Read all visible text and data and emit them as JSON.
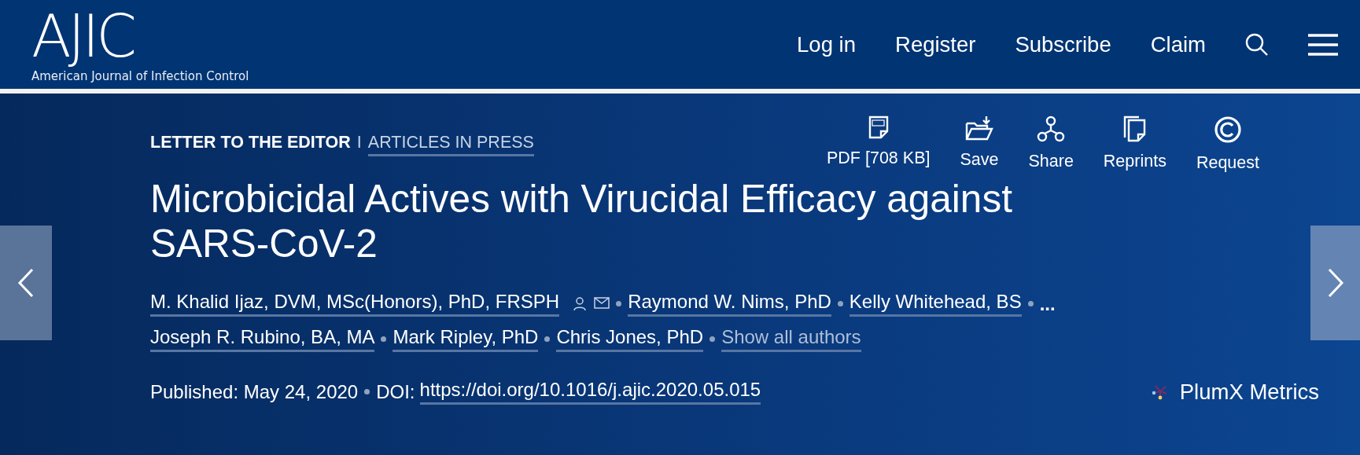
{
  "header": {
    "logo": {
      "mark": "AJIC",
      "subtitle": "American Journal of Infection Control"
    },
    "nav": [
      "Log in",
      "Register",
      "Subscribe",
      "Claim"
    ]
  },
  "article": {
    "category": "LETTER TO THE EDITOR",
    "separator": "I",
    "section": "ARTICLES IN PRESS",
    "tools": [
      {
        "kind": "pdf",
        "label": "PDF [708 KB]"
      },
      {
        "kind": "save",
        "label": "Save"
      },
      {
        "kind": "share",
        "label": "Share"
      },
      {
        "kind": "reprints",
        "label": "Reprints"
      },
      {
        "kind": "request",
        "label": "Request"
      }
    ],
    "title": "Microbicidal Actives with Virucidal Efficacy against SARS-CoV-2",
    "authors": [
      {
        "kind": "author",
        "name": "M. Khalid Ijaz, DVM, MSc(Honors), PhD, FRSPH",
        "contact": true
      },
      {
        "kind": "author",
        "name": "Raymond W. Nims, PhD",
        "contact": false
      },
      {
        "kind": "author",
        "name": "Kelly Whitehead, BS",
        "contact": false
      },
      {
        "kind": "more",
        "name": "..."
      },
      {
        "kind": "author",
        "name": "Joseph R. Rubino, BA, MA",
        "contact": false
      },
      {
        "kind": "author",
        "name": "Mark Ripley, PhD",
        "contact": false
      },
      {
        "kind": "author",
        "name": "Chris Jones, PhD",
        "contact": false
      },
      {
        "kind": "show_all",
        "name": "Show all authors"
      }
    ],
    "published": "Published: May 24, 2020",
    "doi_label": "DOI:",
    "doi": "https://doi.org/10.1016/j.ajic.2020.05.015",
    "plumx": "PlumX Metrics"
  }
}
